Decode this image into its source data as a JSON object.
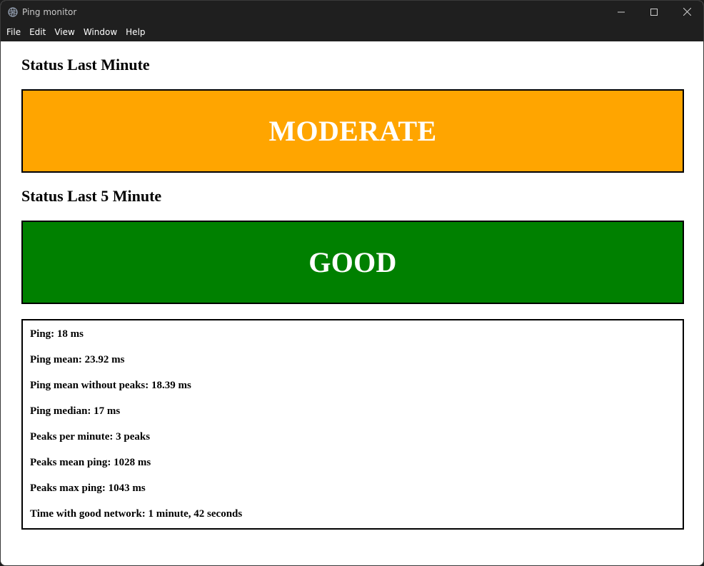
{
  "window": {
    "title": "Ping monitor",
    "controls": {
      "minimize": "—",
      "maximize": "☐",
      "close": "✕"
    }
  },
  "menu": [
    "File",
    "Edit",
    "View",
    "Window",
    "Help"
  ],
  "status_last_minute": {
    "title": "Status Last Minute",
    "value": "MODERATE",
    "color": "#ffa500"
  },
  "status_last_5_minute": {
    "title": "Status Last 5 Minute",
    "value": "GOOD",
    "color": "#008000"
  },
  "stats": [
    "Ping: 18 ms",
    "Ping mean: 23.92 ms",
    "Ping mean without peaks: 18.39 ms",
    "Ping median: 17 ms",
    "Peaks per minute: 3 peaks",
    "Peaks mean ping: 1028 ms",
    "Peaks max ping: 1043 ms",
    "Time with good network: 1 minute, 42 seconds"
  ]
}
